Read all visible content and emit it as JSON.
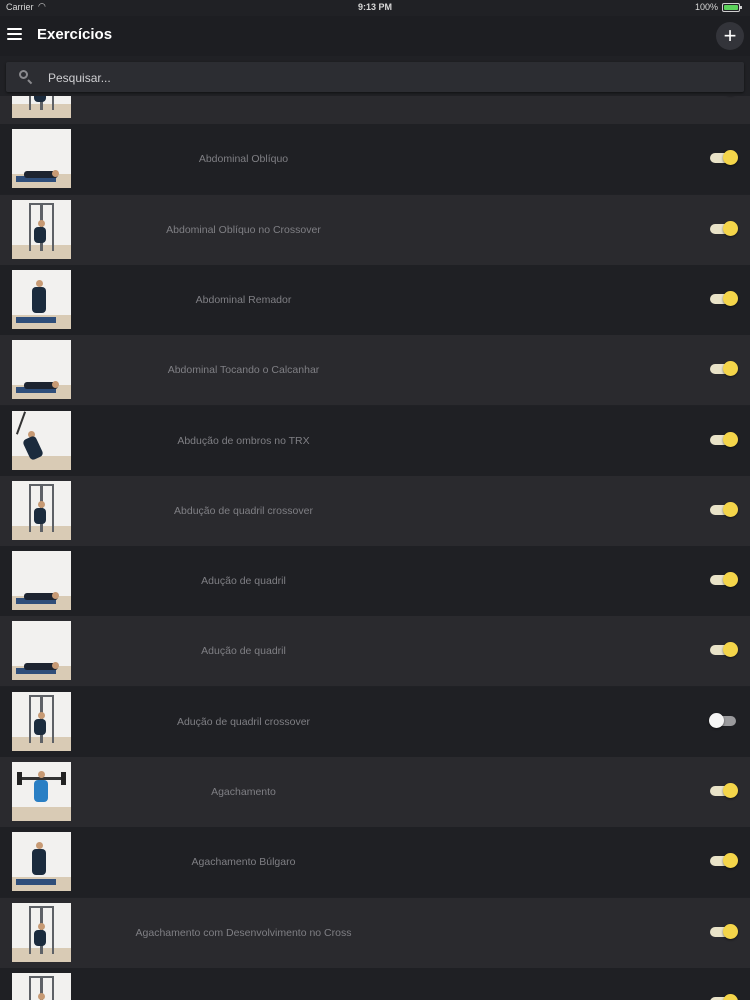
{
  "status_bar": {
    "carrier": "Carrier",
    "time": "9:13 PM",
    "battery": "100%"
  },
  "app_bar": {
    "title": "Exercícios",
    "add_label": "+"
  },
  "search": {
    "placeholder": "Pesquisar...",
    "value": ""
  },
  "colors": {
    "background": "#202125",
    "row_alt": "#2a2a2e",
    "toggle_on": "#f4d54a",
    "label": "#7f7f84"
  },
  "exercises": [
    {
      "label": "",
      "enabled": true,
      "thumb": "machine"
    },
    {
      "label": "Abdominal Oblíquo",
      "enabled": true,
      "thumb": "lying"
    },
    {
      "label": "Abdominal Oblíquo no Crossover",
      "enabled": true,
      "thumb": "machine"
    },
    {
      "label": "Abdominal Remador",
      "enabled": true,
      "thumb": "sitting"
    },
    {
      "label": "Abdominal Tocando o Calcanhar",
      "enabled": true,
      "thumb": "lying"
    },
    {
      "label": "Abdução de ombros no TRX",
      "enabled": true,
      "thumb": "trx"
    },
    {
      "label": "Abdução de quadril crossover",
      "enabled": true,
      "thumb": "machine"
    },
    {
      "label": "Adução de quadril",
      "enabled": true,
      "thumb": "lying"
    },
    {
      "label": "Adução de quadril",
      "enabled": true,
      "thumb": "lying"
    },
    {
      "label": "Adução de quadril crossover",
      "enabled": false,
      "thumb": "machine"
    },
    {
      "label": "Agachamento",
      "enabled": true,
      "thumb": "barbell"
    },
    {
      "label": "Agachamento Búlgaro",
      "enabled": true,
      "thumb": "sitting"
    },
    {
      "label": "Agachamento com Desenvolvimento no Cross",
      "enabled": true,
      "thumb": "machine"
    },
    {
      "label": "",
      "enabled": true,
      "thumb": "machine"
    }
  ]
}
